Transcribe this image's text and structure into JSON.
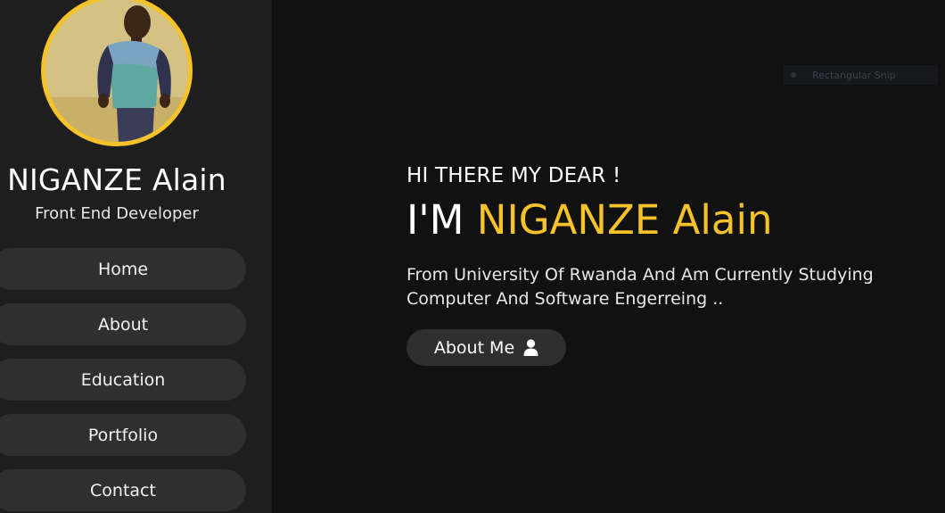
{
  "profile": {
    "name": "NIGANZE Alain",
    "role": "Front End Developer"
  },
  "nav": {
    "items": [
      {
        "label": "Home"
      },
      {
        "label": "About"
      },
      {
        "label": "Education"
      },
      {
        "label": "Portfolio"
      },
      {
        "label": "Contact"
      }
    ]
  },
  "snip": {
    "label": "Rectangular Snip"
  },
  "hero": {
    "greeting": "HI THERE MY DEAR !",
    "headline_prefix": "I'M",
    "headline_name": "NIGANZE Alain",
    "intro": "From University Of Rwanda And Am Currently Studying Computer And Software Engerreing ..",
    "button_label": "About Me",
    "button_icon": "user-icon"
  },
  "colors": {
    "accent": "#f6c22a",
    "background": "#111111",
    "sidebar": "#1e1e1e",
    "button": "#2f2f2f"
  }
}
